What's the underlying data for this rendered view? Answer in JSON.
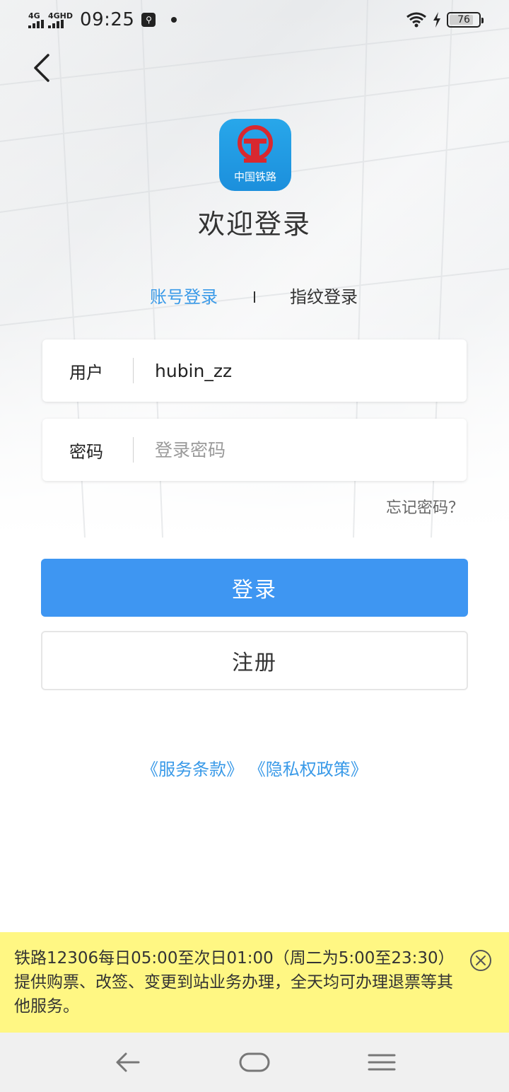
{
  "status_bar": {
    "signal1": "4G",
    "signal2": "4GHD",
    "time": "09:25",
    "battery": "76"
  },
  "header": {
    "logo_text": "中国铁路",
    "welcome": "欢迎登录"
  },
  "tabs": {
    "account": "账号登录",
    "fingerprint": "指纹登录"
  },
  "form": {
    "user_label": "用户",
    "user_value": "hubin_zz",
    "password_label": "密码",
    "password_placeholder": "登录密码",
    "forgot": "忘记密码？"
  },
  "buttons": {
    "login": "登录",
    "register": "注册"
  },
  "legal": {
    "terms": "《服务条款》",
    "privacy": "《隐私权政策》"
  },
  "notice": {
    "text": "铁路12306每日05:00至次日01:00（周二为5:00至23:30）提供购票、改签、变更到站业务办理，全天均可办理退票等其他服务。"
  },
  "colors": {
    "accent": "#3e96f2",
    "link": "#3a9ae8",
    "notice_bg": "#fff783",
    "logo_bg": "#1c8fdc",
    "logo_mark": "#d8282f"
  },
  "icons": {
    "back": "chevron-left-icon",
    "close": "close-circle-icon",
    "nav_back": "arrow-left-icon",
    "nav_home": "home-pill-icon",
    "nav_menu": "menu-icon"
  }
}
